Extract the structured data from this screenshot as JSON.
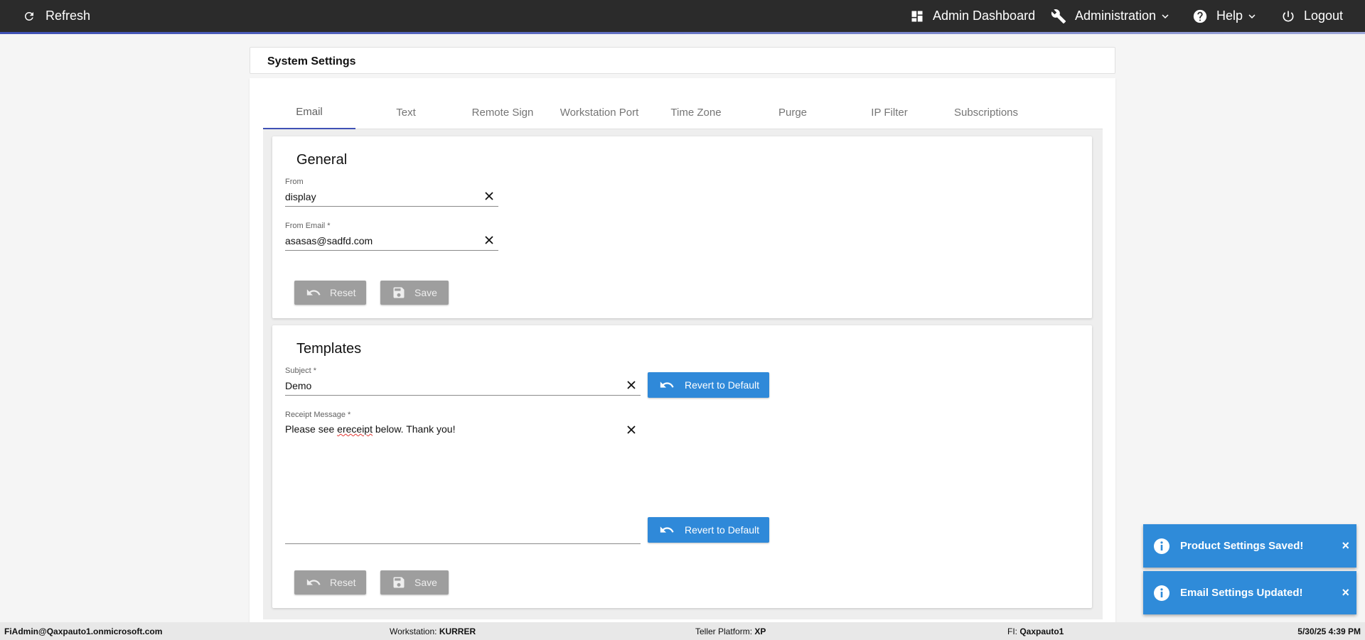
{
  "topbar": {
    "refresh_label": "Refresh",
    "admin_dashboard_label": "Admin Dashboard",
    "administration_label": "Administration",
    "help_label": "Help",
    "logout_label": "Logout"
  },
  "header": {
    "title": "System Settings"
  },
  "tabs": [
    {
      "label": "Email",
      "active": true
    },
    {
      "label": "Text"
    },
    {
      "label": "Remote Sign"
    },
    {
      "label": "Workstation Port"
    },
    {
      "label": "Time Zone"
    },
    {
      "label": "Purge"
    },
    {
      "label": "IP Filter"
    },
    {
      "label": "Subscriptions"
    }
  ],
  "general": {
    "title": "General",
    "from": {
      "label": "From",
      "value": "display"
    },
    "from_email": {
      "label": "From Email *",
      "value": "asasas@sadfd.com"
    },
    "reset_label": "Reset",
    "save_label": "Save"
  },
  "templates": {
    "title": "Templates",
    "subject": {
      "label": "Subject *",
      "value": "Demo"
    },
    "receipt": {
      "label": "Receipt Message *",
      "value_before": "Please see ",
      "value_misspelled": "ereceipt",
      "value_after": " below. Thank you!"
    },
    "revert_label": "Revert to Default",
    "reset_label": "Reset",
    "save_label": "Save"
  },
  "toasts": [
    {
      "text": "Product Settings Saved!",
      "close": "×"
    },
    {
      "text": "Email Settings Updated!",
      "close": "×"
    }
  ],
  "status": {
    "user": "FiAdmin@Qaxpauto1.onmicrosoft.com",
    "workstation_label": "Workstation: ",
    "workstation_value": "KURRER",
    "platform_label": "Teller Platform: ",
    "platform_value": "XP",
    "fi_label": "FI: ",
    "fi_value": "Qaxpauto1",
    "datetime": "5/30/25 4:39 PM"
  },
  "colors": {
    "topbar": "#2b2b2b",
    "accent": "#3f51b5",
    "blue_button": "#2f89d9",
    "grey_button": "#9e9e9e",
    "toast": "#2f8bd9"
  }
}
